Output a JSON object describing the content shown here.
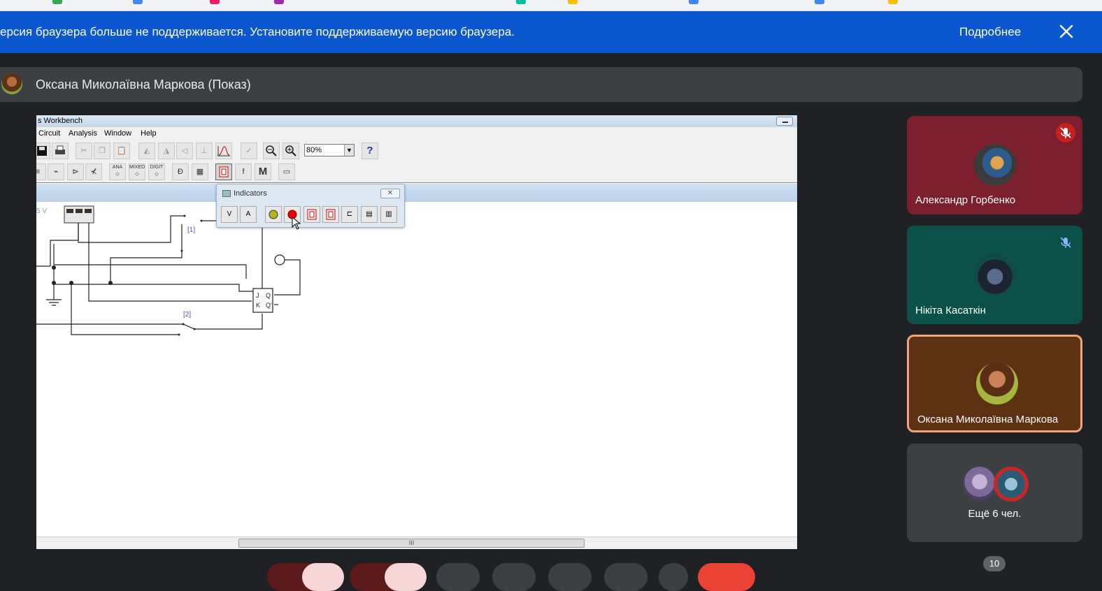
{
  "banner": {
    "message": "ерсия браузера больше не поддерживается. Установите поддерживаемую версию браузера.",
    "more_label": "Подробнее",
    "close_icon": "close-icon"
  },
  "presenter": {
    "name": "Оксана Миколаївна Маркова (Показ)"
  },
  "shared_window": {
    "title": "s Workbench",
    "menu": [
      "Circuit",
      "Analysis",
      "Window",
      "Help"
    ],
    "zoom": "80%",
    "help_label": "?",
    "voltage_label": "5 V",
    "switch1_label": "[1]",
    "switch2_label": "[2]",
    "flipflop": {
      "j": "J",
      "k": "K",
      "q": "Q",
      "qn": "Q'"
    },
    "toolbar2_labels": {
      "ana": "ANA",
      "mixed": "MIXED",
      "digit": "DIGIT",
      "m": "M"
    },
    "scroll_grip": "III",
    "indicators_panel": {
      "title": "Indicators",
      "buttons": [
        "V",
        "A",
        "",
        "",
        "",
        "",
        "",
        "",
        ""
      ]
    }
  },
  "participants": [
    {
      "name": "Александр Горбенко",
      "muted": true
    },
    {
      "name": "Нікіта Касаткін",
      "muted": true
    },
    {
      "name": "Оксана Миколаївна Маркова",
      "muted": false
    }
  ],
  "others": {
    "label": "Ещё 6 чел."
  },
  "participant_count": "10",
  "colors": {
    "banner": "#0b57d0",
    "tile_active_border": "#f2a57a",
    "mute_red": "#c5221f",
    "end_call": "#ea4335"
  }
}
